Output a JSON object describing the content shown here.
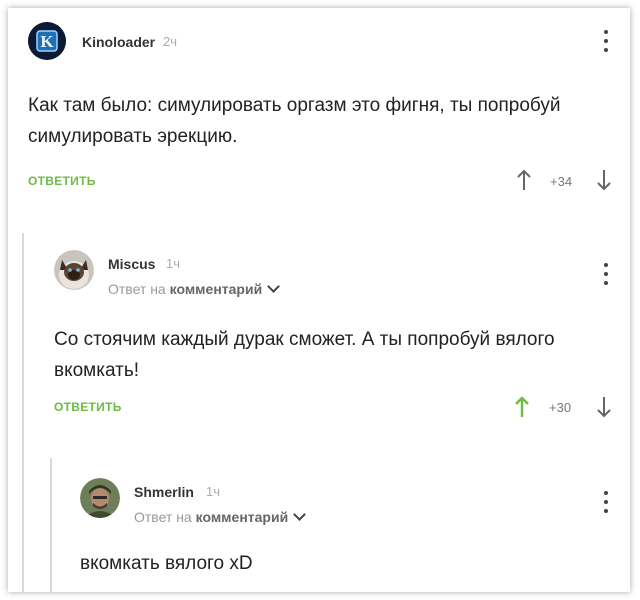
{
  "comments": [
    {
      "author": "Kinoloader",
      "time": "2ч",
      "text": "Как там было: симулировать оргазм это фигня, ты попробуй симулировать эрекцию.",
      "reply_label": "ОТВЕТИТЬ",
      "score": "+34",
      "upvoted": false
    },
    {
      "author": "Miscus",
      "time": "1ч",
      "reply_prefix": "Ответ на",
      "reply_link": "комментарий",
      "text": "Со стоячим каждый дурак сможет. А ты попробуй вялого вкомкать!",
      "reply_label": "ОТВЕТИТЬ",
      "score": "+30",
      "upvoted": true
    },
    {
      "author": "Shmerlin",
      "time": "1ч",
      "reply_prefix": "Ответ на",
      "reply_link": "комментарий",
      "text": "вкомкать вялого xD"
    }
  ],
  "colors": {
    "accent": "#6dbb42",
    "muted": "#aaaaaa",
    "thread_line": "#d9d9d9"
  },
  "icons": [
    "kinoloader-avatar",
    "cat-avatar",
    "soldier-avatar",
    "more-vertical-icon",
    "upvote-icon",
    "downvote-icon",
    "chevron-down-icon"
  ]
}
